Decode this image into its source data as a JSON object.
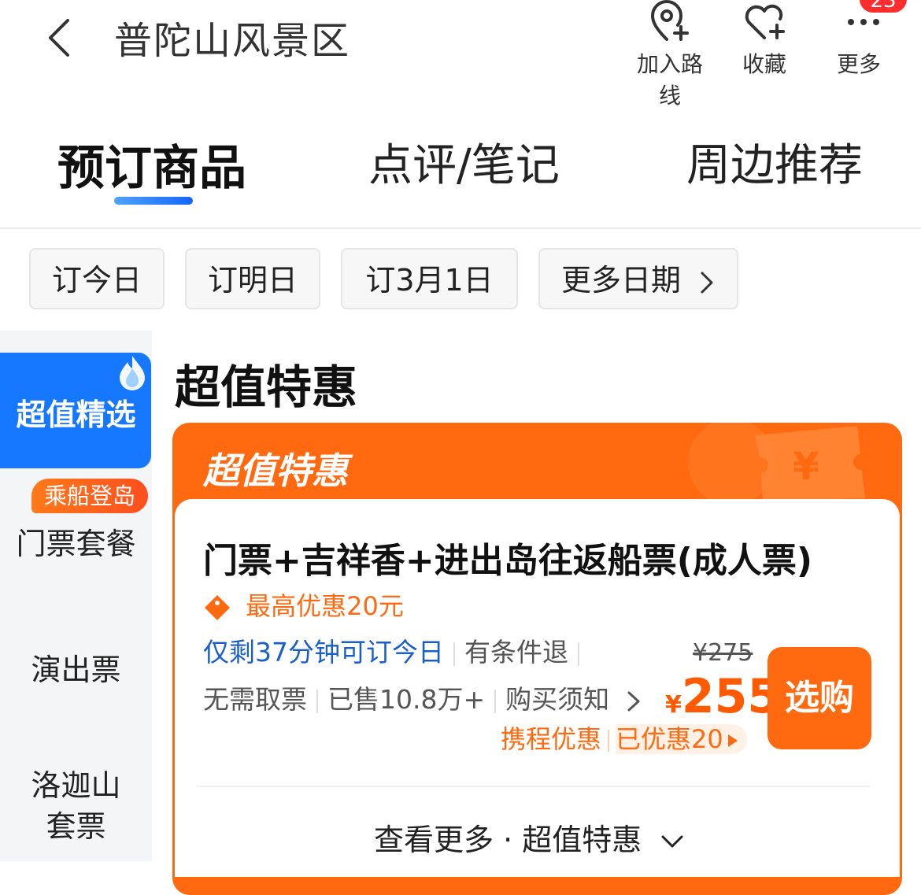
{
  "header": {
    "title": "普陀山风景区",
    "actions": [
      {
        "label": "加入路线",
        "icon": "location-add-icon"
      },
      {
        "label": "收藏",
        "icon": "heart-add-icon"
      },
      {
        "label": "更多",
        "icon": "more-dots-icon"
      }
    ],
    "badge": "23"
  },
  "tabs": [
    {
      "label": "预订商品",
      "active": true
    },
    {
      "label": "点评/笔记",
      "active": false
    },
    {
      "label": "周边推荐",
      "active": false
    }
  ],
  "date_chips": [
    "订今日",
    "订明日",
    "订3月1日",
    "更多日期"
  ],
  "sidebar": {
    "items": [
      {
        "label": "超值精选",
        "active": true
      },
      {
        "label": "门票套餐",
        "tag": "乘船登岛"
      },
      {
        "label": "演出票"
      },
      {
        "label": "洛迦山",
        "label2": "套票"
      }
    ]
  },
  "section": {
    "title": "超值特惠",
    "banner": "超值特惠"
  },
  "product": {
    "title": "门票+吉祥香+进出岛往返船票(成人票)",
    "discount": "最高优惠20元",
    "availability": "仅剩37分钟可订今日",
    "refund": "有条件退",
    "no_pickup": "无需取票",
    "sold": "已售10.8万+",
    "notice": "购买须知",
    "original_price": "¥275",
    "currency": "¥",
    "price": "255",
    "buy_label": "选购",
    "promo_source": "携程优惠",
    "promo_saved": "已优惠20"
  },
  "see_more": "查看更多 · 超值特惠",
  "colors": {
    "accent": "#1677ff",
    "orange": "#ff6a10",
    "red": "#ff2d2d"
  }
}
